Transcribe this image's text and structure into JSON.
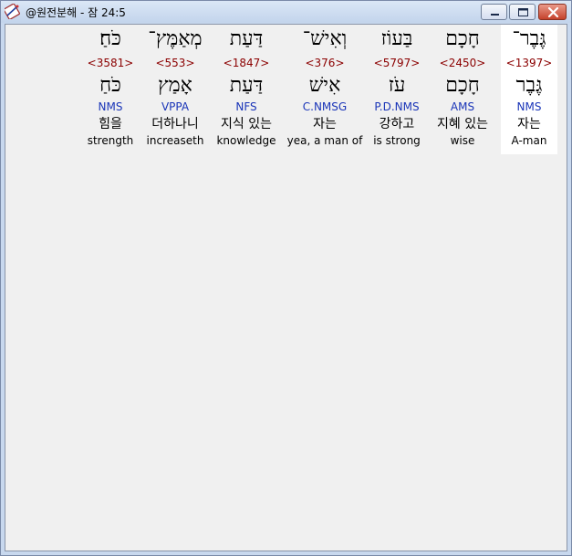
{
  "window": {
    "title": "@원전분해 - 잠 24:5",
    "icons": {
      "app": "pen-notebook-icon",
      "minimize": "minimize-icon",
      "maximize": "maximize-icon",
      "close": "close-icon"
    },
    "colors": {
      "strong_number": "#8b0000",
      "morphology": "#1a35b8",
      "close_button": "#c5422b",
      "selected_background": "#ffffff"
    }
  },
  "words": [
    {
      "hebrew": "גֶּבֶר־",
      "strong": "<1397>",
      "lemma": "גֶּבֶר",
      "morph": "NMS",
      "korean": "자는",
      "english": "A-man",
      "selected": true
    },
    {
      "hebrew": "חָכָם",
      "strong": "<2450>",
      "lemma": "חָכָם",
      "morph": "AMS",
      "korean": "지혜 있는",
      "english": "wise",
      "selected": false
    },
    {
      "hebrew": "בַּעוֹז",
      "strong": "<5797>",
      "lemma": "עֹז",
      "morph": "P.D.NMS",
      "korean": "강하고",
      "english": "is strong",
      "selected": false
    },
    {
      "hebrew": "וְאִישׁ־",
      "strong": "<376>",
      "lemma": "אִישׁ",
      "morph": "C.NMSG",
      "korean": "자는",
      "english": "yea, a man of",
      "selected": false
    },
    {
      "hebrew": "דַּעַת",
      "strong": "<1847>",
      "lemma": "דַּעַת",
      "morph": "NFS",
      "korean": "지식 있는",
      "english": "knowledge",
      "selected": false
    },
    {
      "hebrew": "מְאַמֶּץ־",
      "strong": "<553>",
      "lemma": "אָמַץ",
      "morph": "VPPA",
      "korean": "더하나니",
      "english": "increaseth",
      "selected": false
    },
    {
      "hebrew": "כֹּחַ׃",
      "strong": "<3581>",
      "lemma": "כֹּחַ",
      "morph": "NMS",
      "korean": "힘을",
      "english": "strength",
      "selected": false
    }
  ]
}
